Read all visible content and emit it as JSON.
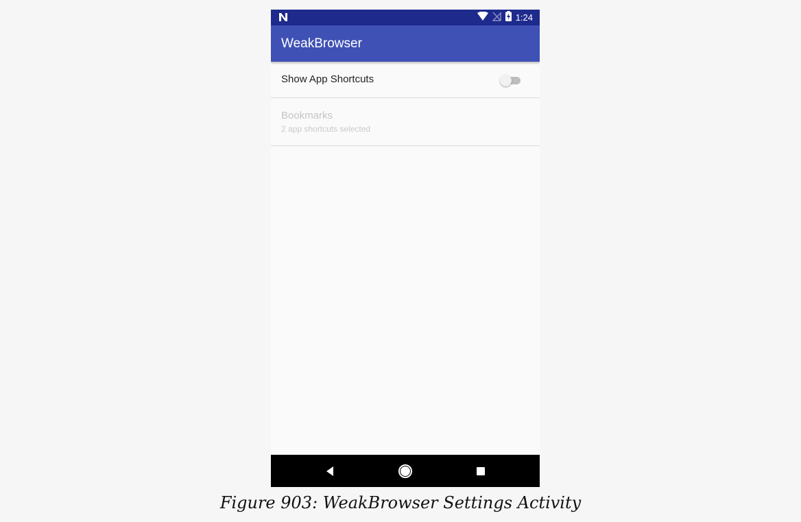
{
  "status_bar": {
    "time": "1:24",
    "icons": [
      "n-logo-icon",
      "wifi-icon",
      "no-sim-icon",
      "battery-charging-icon"
    ]
  },
  "app_bar": {
    "title": "WeakBrowser",
    "color": "#3f51b5"
  },
  "preferences": {
    "show_shortcuts": {
      "title": "Show App Shortcuts",
      "enabled": false
    },
    "bookmarks": {
      "title": "Bookmarks",
      "summary": "2 app shortcuts selected",
      "disabled": true
    }
  },
  "nav_bar": {
    "buttons": [
      "back-icon",
      "home-icon",
      "recents-icon"
    ]
  },
  "caption": "Figure 903: WeakBrowser Settings Activity"
}
